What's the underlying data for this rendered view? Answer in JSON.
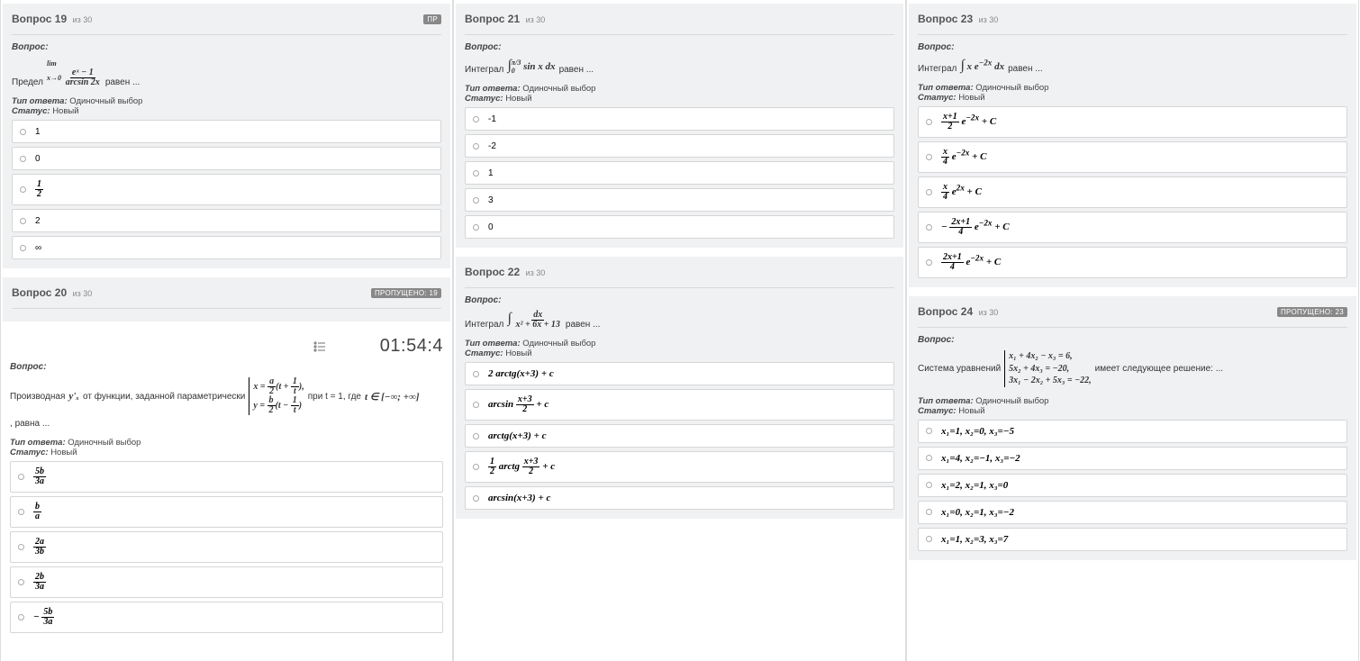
{
  "labels": {
    "question_prefix": "Вопрос",
    "of_total": "из 30",
    "question_label": "Вопрос:",
    "answer_type_label": "Тип ответа:",
    "status_label": "Статус:",
    "answer_type_value": "Одиночный выбор",
    "status_value": "Новый",
    "equals": "равен ...",
    "equals_f": "равна ...",
    "skipped_prefix": "ПРОПУЩЕНО:",
    "timer": "01:54:4"
  },
  "q19": {
    "num": "19",
    "badge": "ПР",
    "prompt_prefix": "Предел",
    "prompt_formula": "lim (eˣ−1)/(arcsin 2x)",
    "prompt_formula_html": "lim x→0 (eˣ − 1) / arcsin 2x",
    "options": [
      "1",
      "0",
      "1/2",
      "2",
      "∞"
    ]
  },
  "q20": {
    "num": "20",
    "badge": "ПРОПУЩЕНО: 19",
    "prompt_prefix": "Производная",
    "prompt_yx": "y'ₓ",
    "prompt_mid": "от функции, заданной параметрически",
    "param_sys_x": "x = (a/2)(t + 1/t),",
    "param_sys_y": "y = (b/2)(t − 1/t)",
    "prompt_at": "при t = 1, где",
    "prompt_domain": "t ∈ [−∞; +∞]",
    "options": [
      "5b/3a",
      "b/a",
      "2a/3b",
      "2b/3a",
      "−5b/3a"
    ]
  },
  "q21": {
    "num": "21",
    "prompt_prefix": "Интеграл",
    "prompt_formula": "∫₀^{π/3} sin x dx",
    "options": [
      "-1",
      "-2",
      "1",
      "3",
      "0"
    ]
  },
  "q22": {
    "num": "22",
    "prompt_prefix": "Интеграл",
    "prompt_formula": "∫ dx / (x² + 6x + 13)",
    "options": [
      "2 arctg(x+3) + c",
      "arcsin((x+3)/2) + c",
      "arctg(x+3) + c",
      "(1/2) arctg((x+3)/2) + c",
      "arcsin(x+3) + c"
    ]
  },
  "q23": {
    "num": "23",
    "prompt_prefix": "Интеграл",
    "prompt_formula": "∫ x e^{−2x} dx",
    "options": [
      "((x+1)/2) e^{−2x} + C",
      "(x/4) e^{−2x} + C",
      "(x/4) e^{2x} + C",
      "−((2x+1)/4) e^{−2x} + C",
      "((2x+1)/4) e^{−2x} + C"
    ]
  },
  "q24": {
    "num": "24",
    "badge": "ПРОПУЩЕНО: 23",
    "prompt_prefix": "Система уравнений",
    "sys1": "x₁ + 4x₂ − x₃ = 6,",
    "sys2": "5x₂ + 4x₃ = −20,",
    "sys3": "3x₁ − 2x₂ + 5x₃ = −22,",
    "prompt_suffix": "имеет следующее решение: ...",
    "options": [
      "x₁=1, x₂=0, x₃=−5",
      "x₁=4, x₂=−1, x₃=−2",
      "x₁=2, x₂=1, x₃=0",
      "x₁=0, x₂=1, x₃=−2",
      "x₁=1, x₂=3, x₃=7"
    ]
  }
}
